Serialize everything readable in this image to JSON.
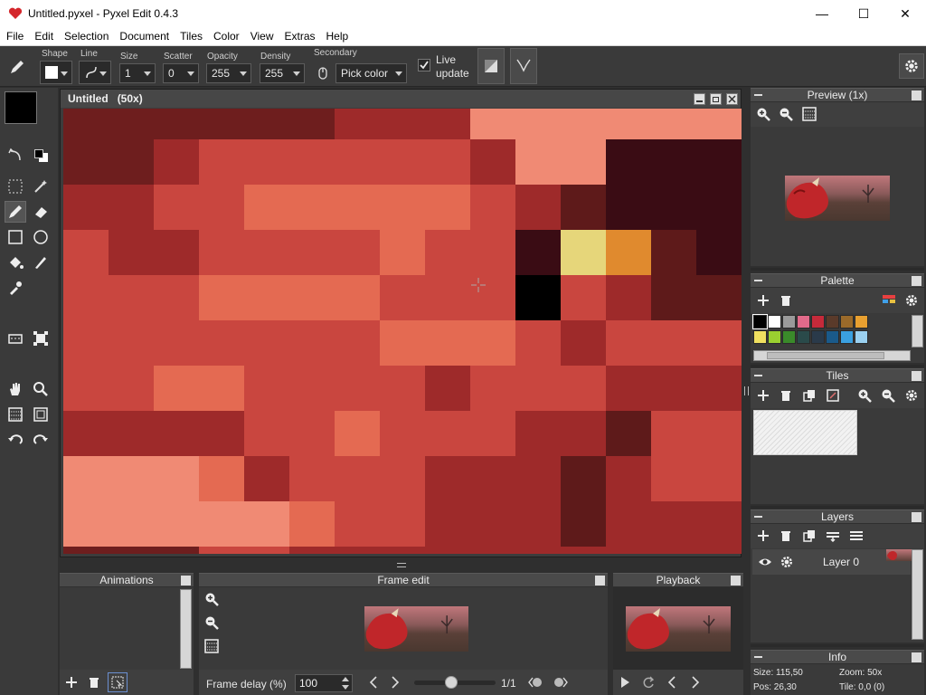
{
  "window": {
    "title": "Untitled.pyxel - Pyxel Edit 0.4.3",
    "min_glyph": "—",
    "max_glyph": "☐",
    "close_glyph": "✕"
  },
  "menu": [
    "File",
    "Edit",
    "Selection",
    "Document",
    "Tiles",
    "Color",
    "View",
    "Extras",
    "Help"
  ],
  "toolbar": {
    "shape_label": "Shape",
    "line_label": "Line",
    "size_label": "Size",
    "size_value": "1",
    "scatter_label": "Scatter",
    "scatter_value": "0",
    "opacity_label": "Opacity",
    "opacity_value": "255",
    "density_label": "Density",
    "density_value": "255",
    "secondary_label": "Secondary",
    "secondary_value": "Pick color",
    "live_update_line1": "Live",
    "live_update_line2": "update",
    "live_update_checked": true
  },
  "canvas": {
    "title": "Untitled",
    "zoom": "(50x)"
  },
  "panels": {
    "preview": "Preview (1x)",
    "palette": "Palette",
    "tiles": "Tiles",
    "layers": "Layers",
    "info": "Info",
    "animations": "Animations",
    "frame_edit": "Frame edit",
    "playback": "Playback"
  },
  "layers": [
    {
      "name": "Layer 0"
    }
  ],
  "info": {
    "size": "Size: 115,50",
    "zoom": "Zoom: 50x",
    "pos": "Pos: 26,30",
    "tile": "Tile: 0,0 (0)"
  },
  "frame": {
    "delay_label": "Frame delay (%)",
    "delay_value": "100",
    "counter": "1/1",
    "slider_fraction": 0.45
  },
  "colors": {
    "primary": "#000000",
    "secondary": "#ffffff",
    "accent_ui": "#3a3a3a"
  },
  "palette": [
    "#000000",
    "#ffffff",
    "#9a9a9a",
    "#e26a8a",
    "#c62a3a",
    "#5a3a2a",
    "#9a6a2a",
    "#e8a030",
    "#f0e060",
    "#9ad030",
    "#3a8a2a",
    "#2a4a4a",
    "#2a3a4a",
    "#1a5a8a",
    "#3aa0e0",
    "#9ad0f0"
  ],
  "icons": {
    "left_tools": [
      "pencil-icon",
      "select-icon",
      "magic-wand-icon",
      "brush-icon",
      "eraser-icon",
      "rect-icon",
      "ellipse-icon",
      "fill-icon",
      "line-pen-icon",
      "eyedropper-icon",
      "move-icon",
      "transform-icon",
      "hand-icon",
      "zoom-icon",
      "grid-icon",
      "frame-icon",
      "undo-icon",
      "redo-icon"
    ]
  }
}
